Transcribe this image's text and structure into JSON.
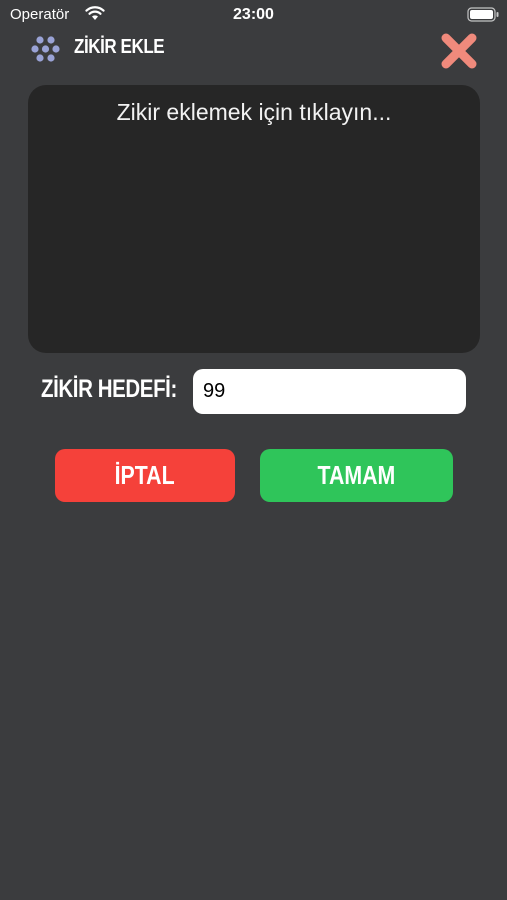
{
  "status_bar": {
    "carrier": "Operatör",
    "time": "23:00",
    "icons": [
      "wifi-icon",
      "battery-icon"
    ]
  },
  "header": {
    "title": "ZİKİR EKLE",
    "icon": "prayer-beads-icon",
    "close_icon": "close-x-icon",
    "close_color": "#f08a7c"
  },
  "zikir_input": {
    "placeholder": "Zikir eklemek için tıklayın..."
  },
  "target": {
    "label": "ZİKİR HEDEFİ:",
    "value": "99"
  },
  "buttons": {
    "cancel_label": "İPTAL",
    "ok_label": "TAMAM"
  },
  "colors": {
    "background": "#3b3c3e",
    "panel": "#262626",
    "cancel": "#f5413a",
    "ok": "#2fc55a"
  }
}
